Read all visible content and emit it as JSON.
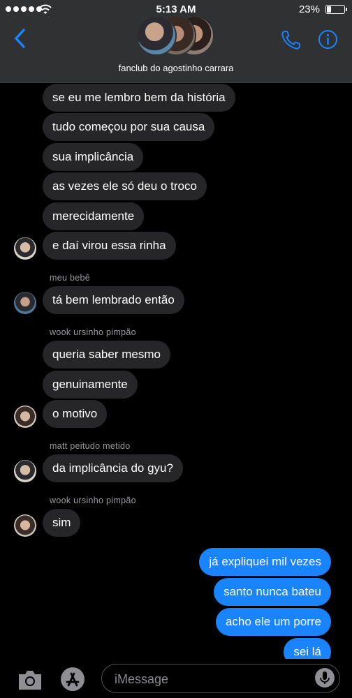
{
  "status_bar": {
    "time": "5:13 AM",
    "battery": "23%",
    "battery_level": 0.23
  },
  "header": {
    "group_name": "fanclub do agostinho carrara"
  },
  "messages": [
    {
      "text": "se eu me lembro bem da história"
    },
    {
      "text": "tudo começou por sua causa"
    },
    {
      "text": "sua implicância"
    },
    {
      "text": "as vezes ele só deu o troco"
    },
    {
      "text": "merecidamente"
    },
    {
      "text": "e daí virou essa rinha"
    },
    {
      "sender": "meu bebê",
      "text": "tá bem lembrado então"
    },
    {
      "sender": "wook ursinho pimpão",
      "text": "queria saber mesmo"
    },
    {
      "text": "genuinamente"
    },
    {
      "text": "o motivo"
    },
    {
      "sender": "matt peitudo metido",
      "text": "da implicância do gyu?"
    },
    {
      "sender": "wook ursinho pimpão",
      "text": "sim"
    }
  ],
  "outgoing": [
    {
      "text": "já expliquei mil vezes"
    },
    {
      "text": "santo nunca bateu"
    },
    {
      "text": "acho ele um porre"
    },
    {
      "text": "sei lá"
    }
  ],
  "composer": {
    "placeholder": "iMessage"
  },
  "colors": {
    "outgoing_bubble": "#1a84fe",
    "incoming_bubble": "#262628",
    "accent": "#1a84fe"
  },
  "icons": [
    "back-chevron-icon",
    "phone-icon",
    "info-icon",
    "camera-icon",
    "app-store-icon",
    "microphone-icon"
  ]
}
